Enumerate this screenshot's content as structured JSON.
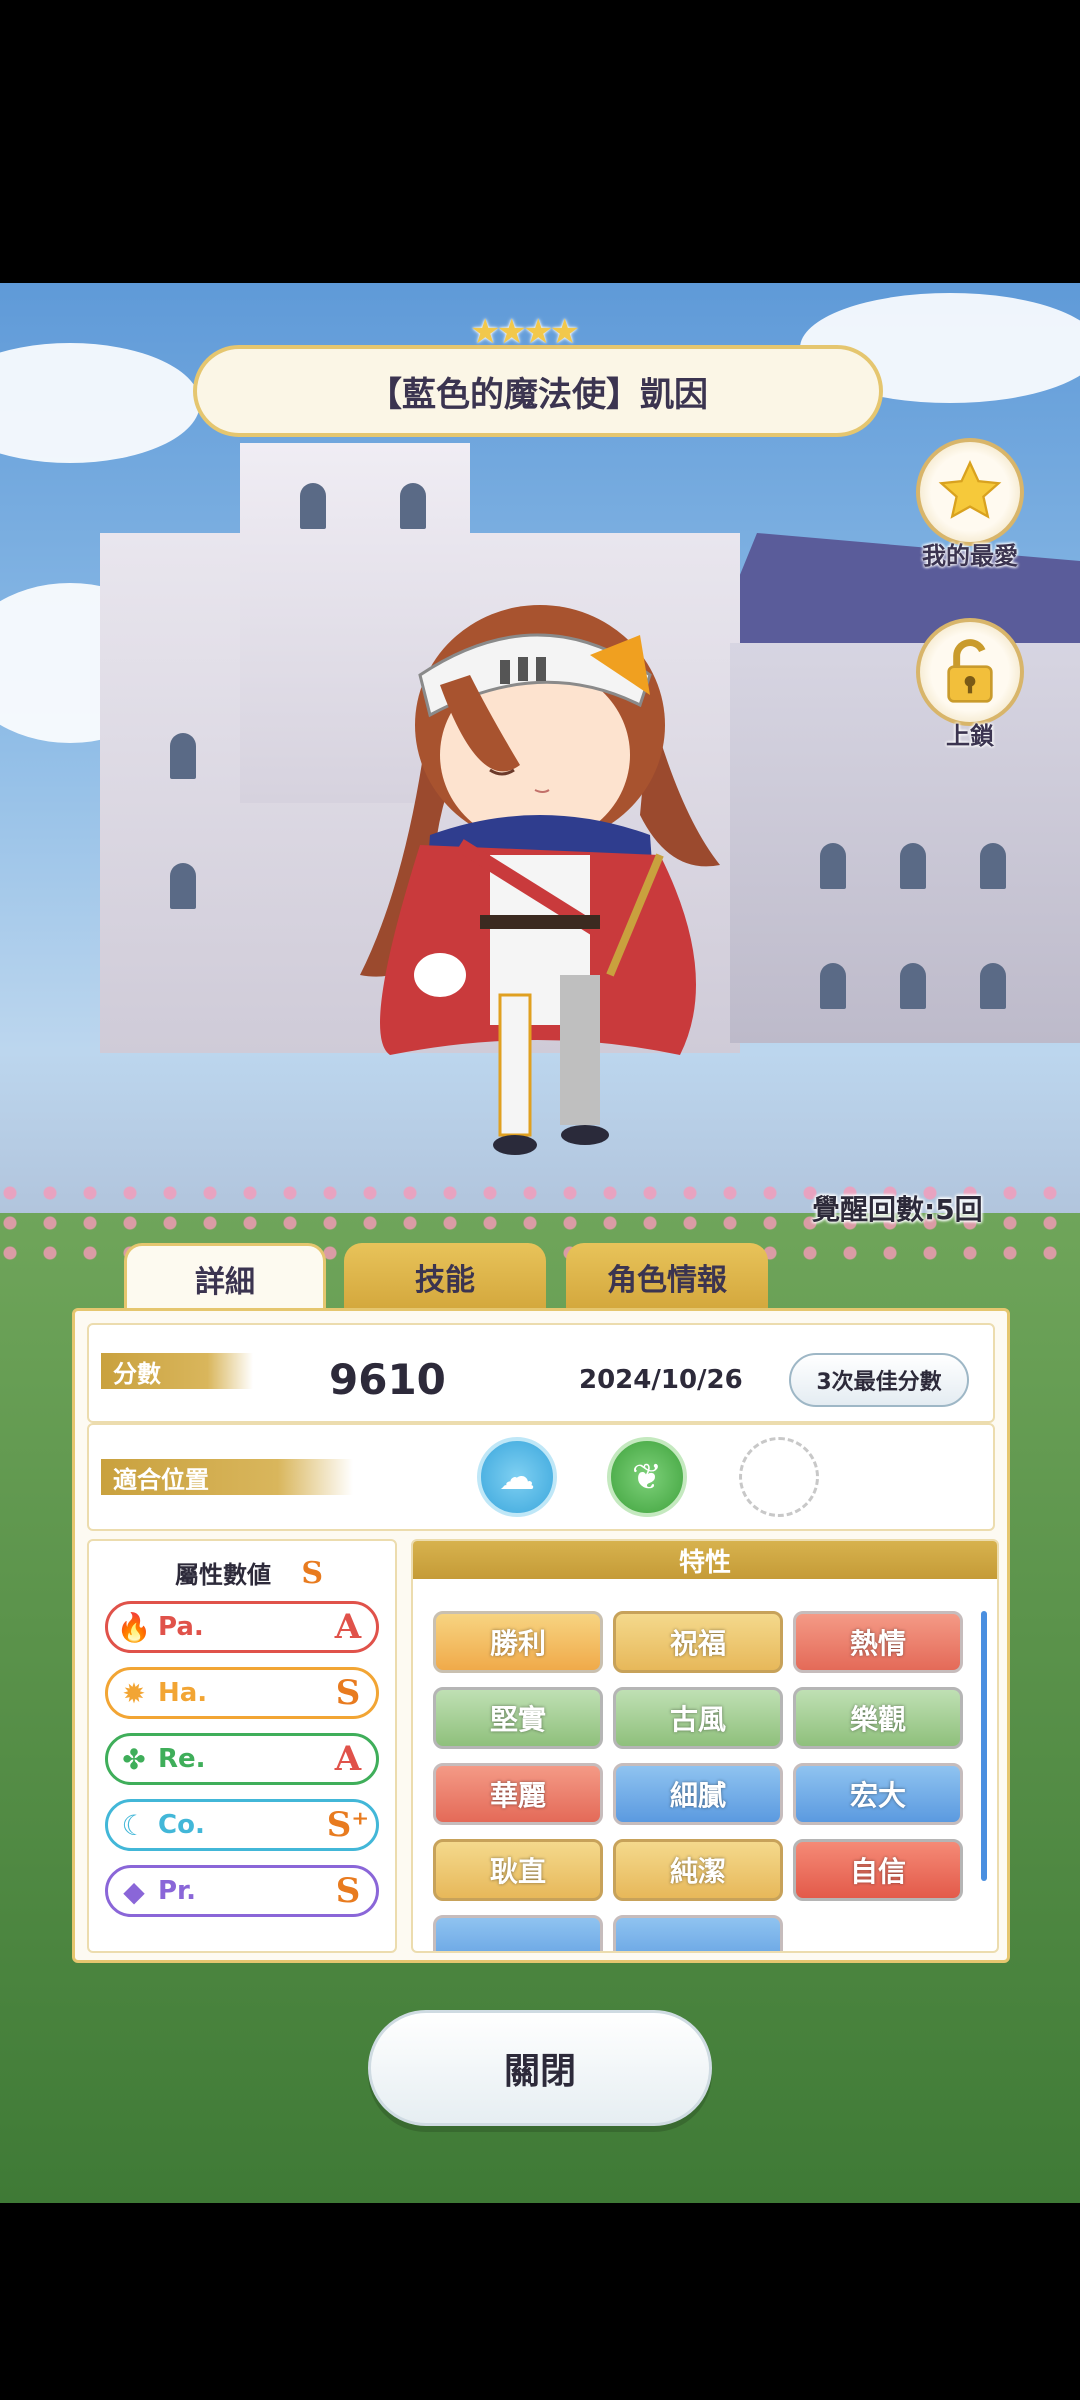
{
  "character": {
    "stars": "★★★★",
    "name": "【藍色的魔法使】凱因",
    "awaken_text": "覺醒回數:5回"
  },
  "side_buttons": {
    "favorite_label": "我的最愛",
    "lock_label": "上鎖"
  },
  "tabs": [
    {
      "label": "詳細",
      "active": true
    },
    {
      "label": "技能",
      "active": false
    },
    {
      "label": "角色情報",
      "active": false
    }
  ],
  "score_row": {
    "label": "分數",
    "score": "9610",
    "date": "2024/10/26",
    "best_button": "3次最佳分數"
  },
  "position_row": {
    "label": "適合位置",
    "icons": [
      "cloud-icon",
      "leaf-spiral-icon",
      "empty-slot"
    ]
  },
  "attributes": {
    "title": "屬性數値",
    "overall_grade": "S",
    "items": [
      {
        "name": "Pa.",
        "grade": "A",
        "color": "#e0524a",
        "icon": "fire-icon"
      },
      {
        "name": "Ha.",
        "grade": "S",
        "color": "#f2a534",
        "icon": "sun-icon"
      },
      {
        "name": "Re.",
        "grade": "A",
        "color": "#3fae5a",
        "icon": "clover-icon"
      },
      {
        "name": "Co.",
        "grade": "S⁺",
        "color": "#42b7d8",
        "icon": "wave-icon"
      },
      {
        "name": "Pr.",
        "grade": "S",
        "color": "#8a66d8",
        "icon": "diamond-icon"
      }
    ]
  },
  "traits": {
    "title": "特性",
    "items": [
      {
        "label": "勝利",
        "style": "t-gold-bright"
      },
      {
        "label": "祝福",
        "style": "t-gold"
      },
      {
        "label": "熱情",
        "style": "t-red"
      },
      {
        "label": "堅實",
        "style": "t-green"
      },
      {
        "label": "古風",
        "style": "t-green"
      },
      {
        "label": "樂觀",
        "style": "t-green"
      },
      {
        "label": "華麗",
        "style": "t-red"
      },
      {
        "label": "細膩",
        "style": "t-blue"
      },
      {
        "label": "宏大",
        "style": "t-blue"
      },
      {
        "label": "耿直",
        "style": "t-gold"
      },
      {
        "label": "純潔",
        "style": "t-gold"
      },
      {
        "label": "自信",
        "style": "t-red-dark"
      }
    ]
  },
  "close_button": "關閉"
}
